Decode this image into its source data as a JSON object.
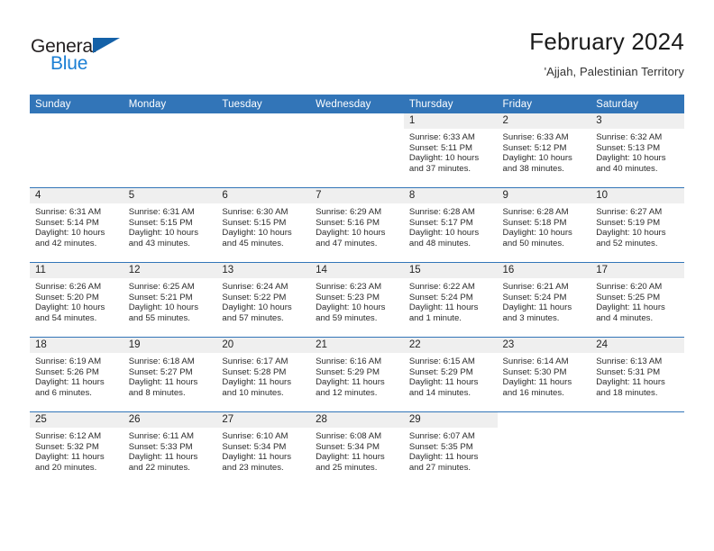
{
  "brand": {
    "name_part1": "General",
    "name_part2": "Blue",
    "flag_icon": "triangle-flag-icon",
    "accent_color": "#1b7fd4"
  },
  "header": {
    "title": "February 2024",
    "subtitle": "'Ajjah, Palestinian Territory"
  },
  "theme": {
    "header_blue": "#3275b8",
    "daynum_gray": "#efefef",
    "text_dark": "#232323"
  },
  "calendar": {
    "weekday_headers": [
      "Sunday",
      "Monday",
      "Tuesday",
      "Wednesday",
      "Thursday",
      "Friday",
      "Saturday"
    ],
    "weeks": [
      [
        {
          "day": "",
          "blank": true,
          "sunrise": "",
          "sunset": "",
          "daylight_line1": "",
          "daylight_line2": ""
        },
        {
          "day": "",
          "blank": true,
          "sunrise": "",
          "sunset": "",
          "daylight_line1": "",
          "daylight_line2": ""
        },
        {
          "day": "",
          "blank": true,
          "sunrise": "",
          "sunset": "",
          "daylight_line1": "",
          "daylight_line2": ""
        },
        {
          "day": "",
          "blank": true,
          "sunrise": "",
          "sunset": "",
          "daylight_line1": "",
          "daylight_line2": ""
        },
        {
          "day": "1",
          "sunrise": "Sunrise: 6:33 AM",
          "sunset": "Sunset: 5:11 PM",
          "daylight_line1": "Daylight: 10 hours",
          "daylight_line2": "and 37 minutes."
        },
        {
          "day": "2",
          "sunrise": "Sunrise: 6:33 AM",
          "sunset": "Sunset: 5:12 PM",
          "daylight_line1": "Daylight: 10 hours",
          "daylight_line2": "and 38 minutes."
        },
        {
          "day": "3",
          "sunrise": "Sunrise: 6:32 AM",
          "sunset": "Sunset: 5:13 PM",
          "daylight_line1": "Daylight: 10 hours",
          "daylight_line2": "and 40 minutes."
        }
      ],
      [
        {
          "day": "4",
          "sunrise": "Sunrise: 6:31 AM",
          "sunset": "Sunset: 5:14 PM",
          "daylight_line1": "Daylight: 10 hours",
          "daylight_line2": "and 42 minutes."
        },
        {
          "day": "5",
          "sunrise": "Sunrise: 6:31 AM",
          "sunset": "Sunset: 5:15 PM",
          "daylight_line1": "Daylight: 10 hours",
          "daylight_line2": "and 43 minutes."
        },
        {
          "day": "6",
          "sunrise": "Sunrise: 6:30 AM",
          "sunset": "Sunset: 5:15 PM",
          "daylight_line1": "Daylight: 10 hours",
          "daylight_line2": "and 45 minutes."
        },
        {
          "day": "7",
          "sunrise": "Sunrise: 6:29 AM",
          "sunset": "Sunset: 5:16 PM",
          "daylight_line1": "Daylight: 10 hours",
          "daylight_line2": "and 47 minutes."
        },
        {
          "day": "8",
          "sunrise": "Sunrise: 6:28 AM",
          "sunset": "Sunset: 5:17 PM",
          "daylight_line1": "Daylight: 10 hours",
          "daylight_line2": "and 48 minutes."
        },
        {
          "day": "9",
          "sunrise": "Sunrise: 6:28 AM",
          "sunset": "Sunset: 5:18 PM",
          "daylight_line1": "Daylight: 10 hours",
          "daylight_line2": "and 50 minutes."
        },
        {
          "day": "10",
          "sunrise": "Sunrise: 6:27 AM",
          "sunset": "Sunset: 5:19 PM",
          "daylight_line1": "Daylight: 10 hours",
          "daylight_line2": "and 52 minutes."
        }
      ],
      [
        {
          "day": "11",
          "sunrise": "Sunrise: 6:26 AM",
          "sunset": "Sunset: 5:20 PM",
          "daylight_line1": "Daylight: 10 hours",
          "daylight_line2": "and 54 minutes."
        },
        {
          "day": "12",
          "sunrise": "Sunrise: 6:25 AM",
          "sunset": "Sunset: 5:21 PM",
          "daylight_line1": "Daylight: 10 hours",
          "daylight_line2": "and 55 minutes."
        },
        {
          "day": "13",
          "sunrise": "Sunrise: 6:24 AM",
          "sunset": "Sunset: 5:22 PM",
          "daylight_line1": "Daylight: 10 hours",
          "daylight_line2": "and 57 minutes."
        },
        {
          "day": "14",
          "sunrise": "Sunrise: 6:23 AM",
          "sunset": "Sunset: 5:23 PM",
          "daylight_line1": "Daylight: 10 hours",
          "daylight_line2": "and 59 minutes."
        },
        {
          "day": "15",
          "sunrise": "Sunrise: 6:22 AM",
          "sunset": "Sunset: 5:24 PM",
          "daylight_line1": "Daylight: 11 hours",
          "daylight_line2": "and 1 minute."
        },
        {
          "day": "16",
          "sunrise": "Sunrise: 6:21 AM",
          "sunset": "Sunset: 5:24 PM",
          "daylight_line1": "Daylight: 11 hours",
          "daylight_line2": "and 3 minutes."
        },
        {
          "day": "17",
          "sunrise": "Sunrise: 6:20 AM",
          "sunset": "Sunset: 5:25 PM",
          "daylight_line1": "Daylight: 11 hours",
          "daylight_line2": "and 4 minutes."
        }
      ],
      [
        {
          "day": "18",
          "sunrise": "Sunrise: 6:19 AM",
          "sunset": "Sunset: 5:26 PM",
          "daylight_line1": "Daylight: 11 hours",
          "daylight_line2": "and 6 minutes."
        },
        {
          "day": "19",
          "sunrise": "Sunrise: 6:18 AM",
          "sunset": "Sunset: 5:27 PM",
          "daylight_line1": "Daylight: 11 hours",
          "daylight_line2": "and 8 minutes."
        },
        {
          "day": "20",
          "sunrise": "Sunrise: 6:17 AM",
          "sunset": "Sunset: 5:28 PM",
          "daylight_line1": "Daylight: 11 hours",
          "daylight_line2": "and 10 minutes."
        },
        {
          "day": "21",
          "sunrise": "Sunrise: 6:16 AM",
          "sunset": "Sunset: 5:29 PM",
          "daylight_line1": "Daylight: 11 hours",
          "daylight_line2": "and 12 minutes."
        },
        {
          "day": "22",
          "sunrise": "Sunrise: 6:15 AM",
          "sunset": "Sunset: 5:29 PM",
          "daylight_line1": "Daylight: 11 hours",
          "daylight_line2": "and 14 minutes."
        },
        {
          "day": "23",
          "sunrise": "Sunrise: 6:14 AM",
          "sunset": "Sunset: 5:30 PM",
          "daylight_line1": "Daylight: 11 hours",
          "daylight_line2": "and 16 minutes."
        },
        {
          "day": "24",
          "sunrise": "Sunrise: 6:13 AM",
          "sunset": "Sunset: 5:31 PM",
          "daylight_line1": "Daylight: 11 hours",
          "daylight_line2": "and 18 minutes."
        }
      ],
      [
        {
          "day": "25",
          "sunrise": "Sunrise: 6:12 AM",
          "sunset": "Sunset: 5:32 PM",
          "daylight_line1": "Daylight: 11 hours",
          "daylight_line2": "and 20 minutes."
        },
        {
          "day": "26",
          "sunrise": "Sunrise: 6:11 AM",
          "sunset": "Sunset: 5:33 PM",
          "daylight_line1": "Daylight: 11 hours",
          "daylight_line2": "and 22 minutes."
        },
        {
          "day": "27",
          "sunrise": "Sunrise: 6:10 AM",
          "sunset": "Sunset: 5:34 PM",
          "daylight_line1": "Daylight: 11 hours",
          "daylight_line2": "and 23 minutes."
        },
        {
          "day": "28",
          "sunrise": "Sunrise: 6:08 AM",
          "sunset": "Sunset: 5:34 PM",
          "daylight_line1": "Daylight: 11 hours",
          "daylight_line2": "and 25 minutes."
        },
        {
          "day": "29",
          "sunrise": "Sunrise: 6:07 AM",
          "sunset": "Sunset: 5:35 PM",
          "daylight_line1": "Daylight: 11 hours",
          "daylight_line2": "and 27 minutes."
        },
        {
          "day": "",
          "blank": true,
          "sunrise": "",
          "sunset": "",
          "daylight_line1": "",
          "daylight_line2": ""
        },
        {
          "day": "",
          "blank": true,
          "sunrise": "",
          "sunset": "",
          "daylight_line1": "",
          "daylight_line2": ""
        }
      ]
    ]
  }
}
